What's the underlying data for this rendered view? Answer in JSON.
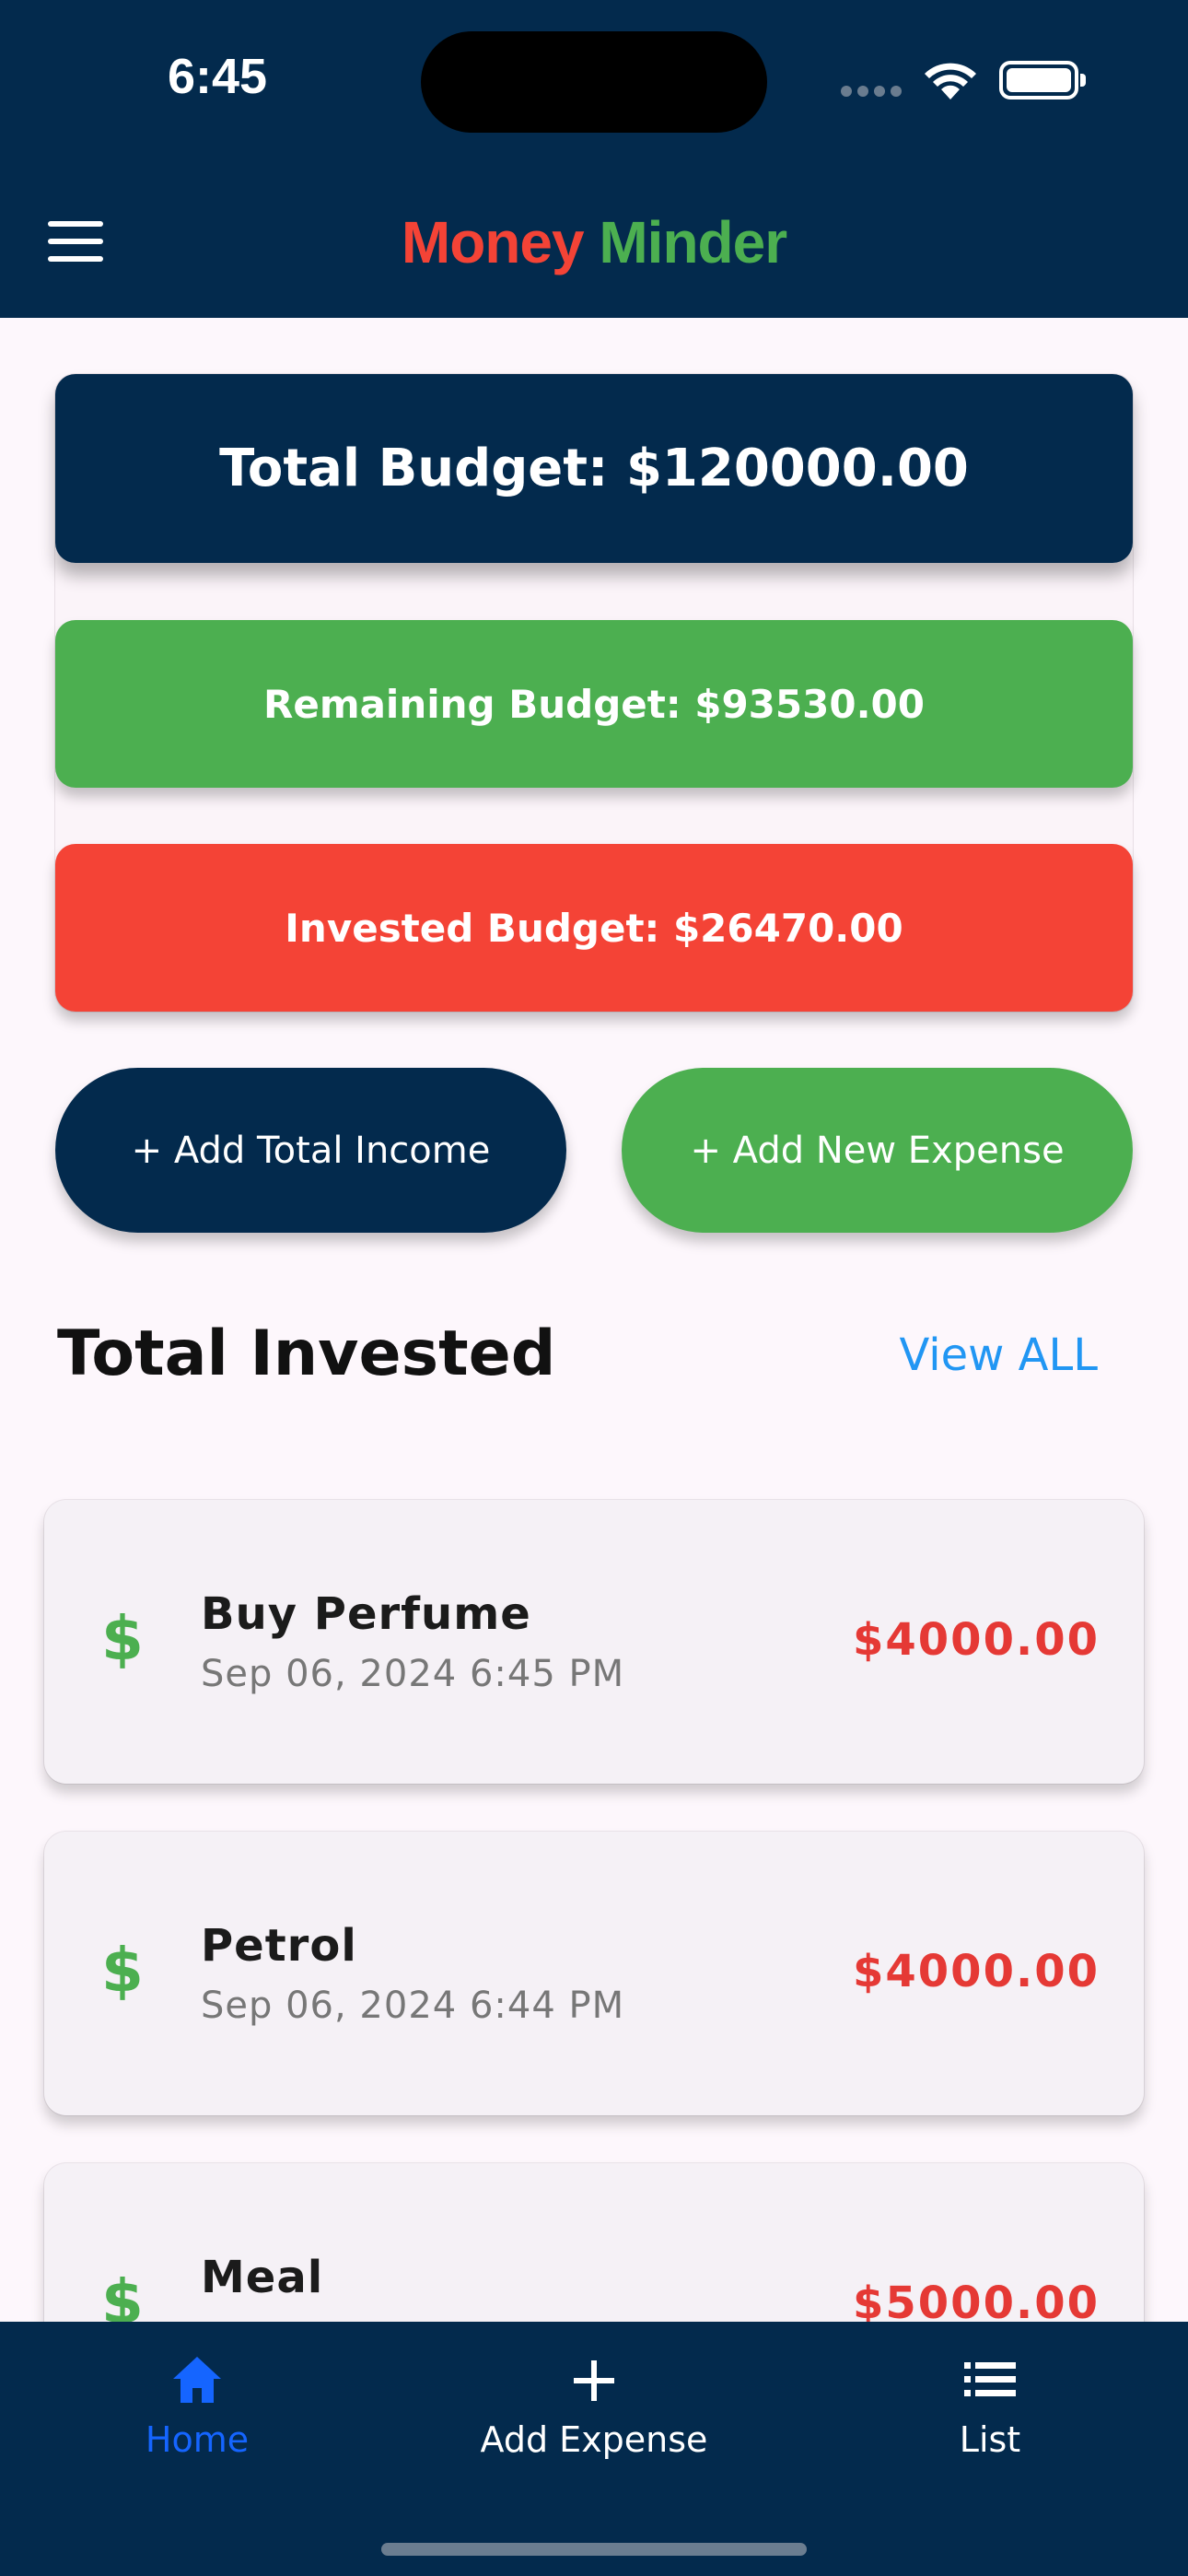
{
  "status_bar": {
    "time": "6:45"
  },
  "app_bar": {
    "title_part1": "Money",
    "title_part2": "Minder"
  },
  "budget": {
    "total": "Total Budget: $120000.00",
    "remaining": "Remaining Budget: $93530.00",
    "invested": "Invested Budget: $26470.00"
  },
  "actions": {
    "add_income": "+ Add Total Income",
    "add_expense": "+ Add New Expense"
  },
  "section": {
    "title": "Total Invested",
    "view_all": "View ALL"
  },
  "items": [
    {
      "name": "Buy Perfume",
      "date": "Sep 06, 2024 6:45 PM",
      "amount": "$4000.00",
      "icon": "$"
    },
    {
      "name": "Petrol",
      "date": "Sep 06, 2024 6:44 PM",
      "amount": "$4000.00",
      "icon": "$"
    },
    {
      "name": "Meal",
      "date": "",
      "amount": "$5000.00",
      "icon": "$"
    }
  ],
  "bottom_nav": {
    "home": "Home",
    "add_expense": "Add Expense",
    "list": "List"
  },
  "colors": {
    "navy": "#032a4d",
    "green": "#4caf50",
    "red": "#f44336",
    "link_blue": "#2196f3",
    "active_nav": "#1565ff"
  }
}
